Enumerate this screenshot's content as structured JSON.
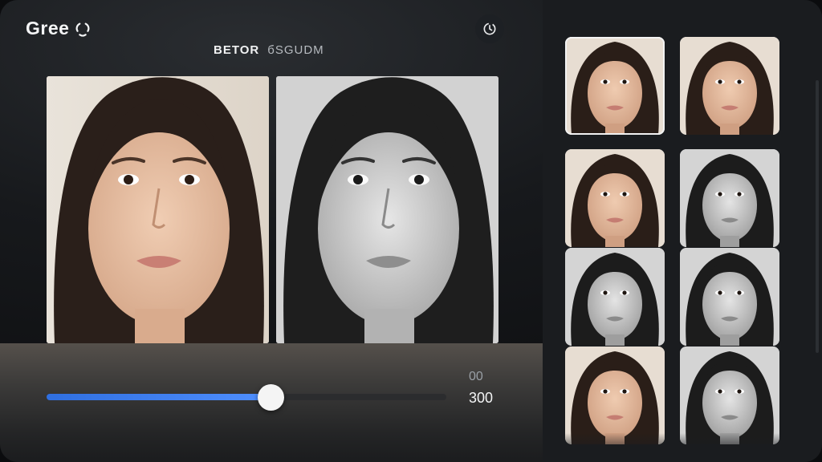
{
  "app": {
    "logo_text": "Gree"
  },
  "header": {
    "before_label": "BETOR",
    "after_label": "бSGUDM"
  },
  "editor": {
    "before_image": "portrait-before",
    "after_image": "portrait-after-monochrome",
    "slider": {
      "value_fraction": 0.56,
      "top_value": "00",
      "main_value": "300"
    }
  },
  "icons": {
    "logo": "loop-logo-icon",
    "top_right": "history-icon"
  },
  "colors": {
    "accent": "#3b7cf0",
    "background": "#17191c",
    "panel": "#1a1c1f"
  },
  "gallery": {
    "selected_index": 0,
    "items": [
      {
        "name": "portrait-thumb-1",
        "tone": "color"
      },
      {
        "name": "portrait-thumb-2",
        "tone": "color"
      },
      {
        "name": "portrait-thumb-3",
        "tone": "color"
      },
      {
        "name": "portrait-thumb-4",
        "tone": "mono"
      },
      {
        "name": "portrait-thumb-5",
        "tone": "mono"
      },
      {
        "name": "portrait-thumb-6",
        "tone": "mono"
      },
      {
        "name": "portrait-thumb-7",
        "tone": "color"
      },
      {
        "name": "portrait-thumb-8",
        "tone": "mono"
      }
    ]
  }
}
